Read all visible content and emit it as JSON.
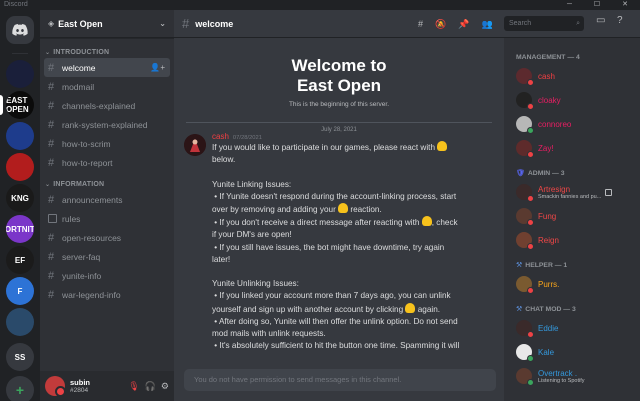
{
  "window": {
    "title": "Discord",
    "controls": "─ ☐ ✕"
  },
  "servers": [
    {
      "label": ""
    },
    {
      "label": "EAST OPEN"
    },
    {
      "label": ""
    },
    {
      "label": ""
    },
    {
      "label": "KNG"
    },
    {
      "label": "FORTNITE"
    },
    {
      "label": "EF"
    },
    {
      "label": "F"
    },
    {
      "label": ""
    },
    {
      "label": "SS"
    },
    {
      "label": "+"
    },
    {
      "label": "↓"
    }
  ],
  "sidebar": {
    "server_name": "East Open",
    "categories": [
      {
        "name": "INTRODUCTION",
        "channels": [
          "welcome",
          "modmail",
          "channels-explained",
          "rank-system-explained",
          "how-to-scrim",
          "how-to-report"
        ]
      },
      {
        "name": "INFORMATION",
        "channels": [
          "announcements",
          "rules",
          "open-resources",
          "server-faq",
          "yunite-info",
          "war-legend-info"
        ]
      }
    ]
  },
  "user": {
    "name": "subin",
    "discriminator": "#2804"
  },
  "channel": {
    "name": "welcome",
    "welcome_title_line1": "Welcome to",
    "welcome_title_line2": "East Open",
    "welcome_sub": "This is the beginning of this server.",
    "date_divider": "July 28, 2021"
  },
  "message": {
    "author": "cash",
    "timestamp": "07/28/2021",
    "lines": [
      "If you would like to participate in our games, please react with ✋",
      "below.",
      "",
      "Yunite Linking Issues:",
      " • If Yunite doesn't respond during the account-linking process, start",
      "over by removing and adding your ✋ reaction.",
      " • If you don't receive a direct message after reacting with ✋, check",
      "if your DM's are open!",
      " • If you still have issues, the bot might have downtime, try again",
      "later!",
      "",
      "Yunite Unlinking Issues:",
      " • If you linked your account more than 7 days ago, you can unlink",
      "yourself and sign up with another account by clicking ✋ again.",
      " • After doing so, Yunite will then offer the unlink option. Do not send",
      "mod mails with unlink requests.",
      " • It's absolutely sufficient to hit the button one time. Spamming it will"
    ]
  },
  "composer": {
    "placeholder": "You do not have permission to send messages in this channel."
  },
  "search": {
    "placeholder": "Search"
  },
  "members": {
    "groups": [
      {
        "title": "MANAGEMENT — 4",
        "icon": "",
        "items": [
          {
            "name": "cash",
            "color": "#f23f42",
            "status": "#ed4245",
            "avatar": "#5c2a2e"
          },
          {
            "name": "cloaky",
            "color": "#e91e63",
            "status": "#ed4245",
            "avatar": "#222"
          },
          {
            "name": "connoreo",
            "color": "#e91e63",
            "status": "#3ba55d",
            "avatar": "#b7b7b7"
          },
          {
            "name": "Zay!",
            "color": "#e91e63",
            "status": "#ed4245",
            "avatar": "#5e2b2b"
          }
        ]
      },
      {
        "title": "ADMIN — 3",
        "icon": "shield",
        "items": [
          {
            "name": "Artresign",
            "color": "#f04747",
            "status": "#ed4245",
            "avatar": "#3a2a2a",
            "activity": "Smackin fannies and pu...",
            "badge": true
          },
          {
            "name": "Fung",
            "color": "#f04747",
            "status": "#ed4245",
            "avatar": "#5a3a30"
          },
          {
            "name": "Reign",
            "color": "#f04747",
            "status": "#ed4245",
            "avatar": "#704030"
          }
        ]
      },
      {
        "title": "HELPER — 1",
        "icon": "tools",
        "items": [
          {
            "name": "Purrs.",
            "color": "#faa61a",
            "status": "#ed4245",
            "avatar": "#7a5a30"
          }
        ]
      },
      {
        "title": "CHAT MOD — 3",
        "icon": "tools",
        "items": [
          {
            "name": "Eddie",
            "color": "#3498db",
            "status": "#ed4245",
            "avatar": "#3a2a2a"
          },
          {
            "name": "Kale",
            "color": "#3498db",
            "status": "#3ba55d",
            "avatar": "#e8e8e8"
          },
          {
            "name": "Overtrack .",
            "color": "#3498db",
            "status": "#3ba55d",
            "avatar": "#5a3a30",
            "activity": "Listening to Spotify"
          }
        ]
      }
    ]
  }
}
